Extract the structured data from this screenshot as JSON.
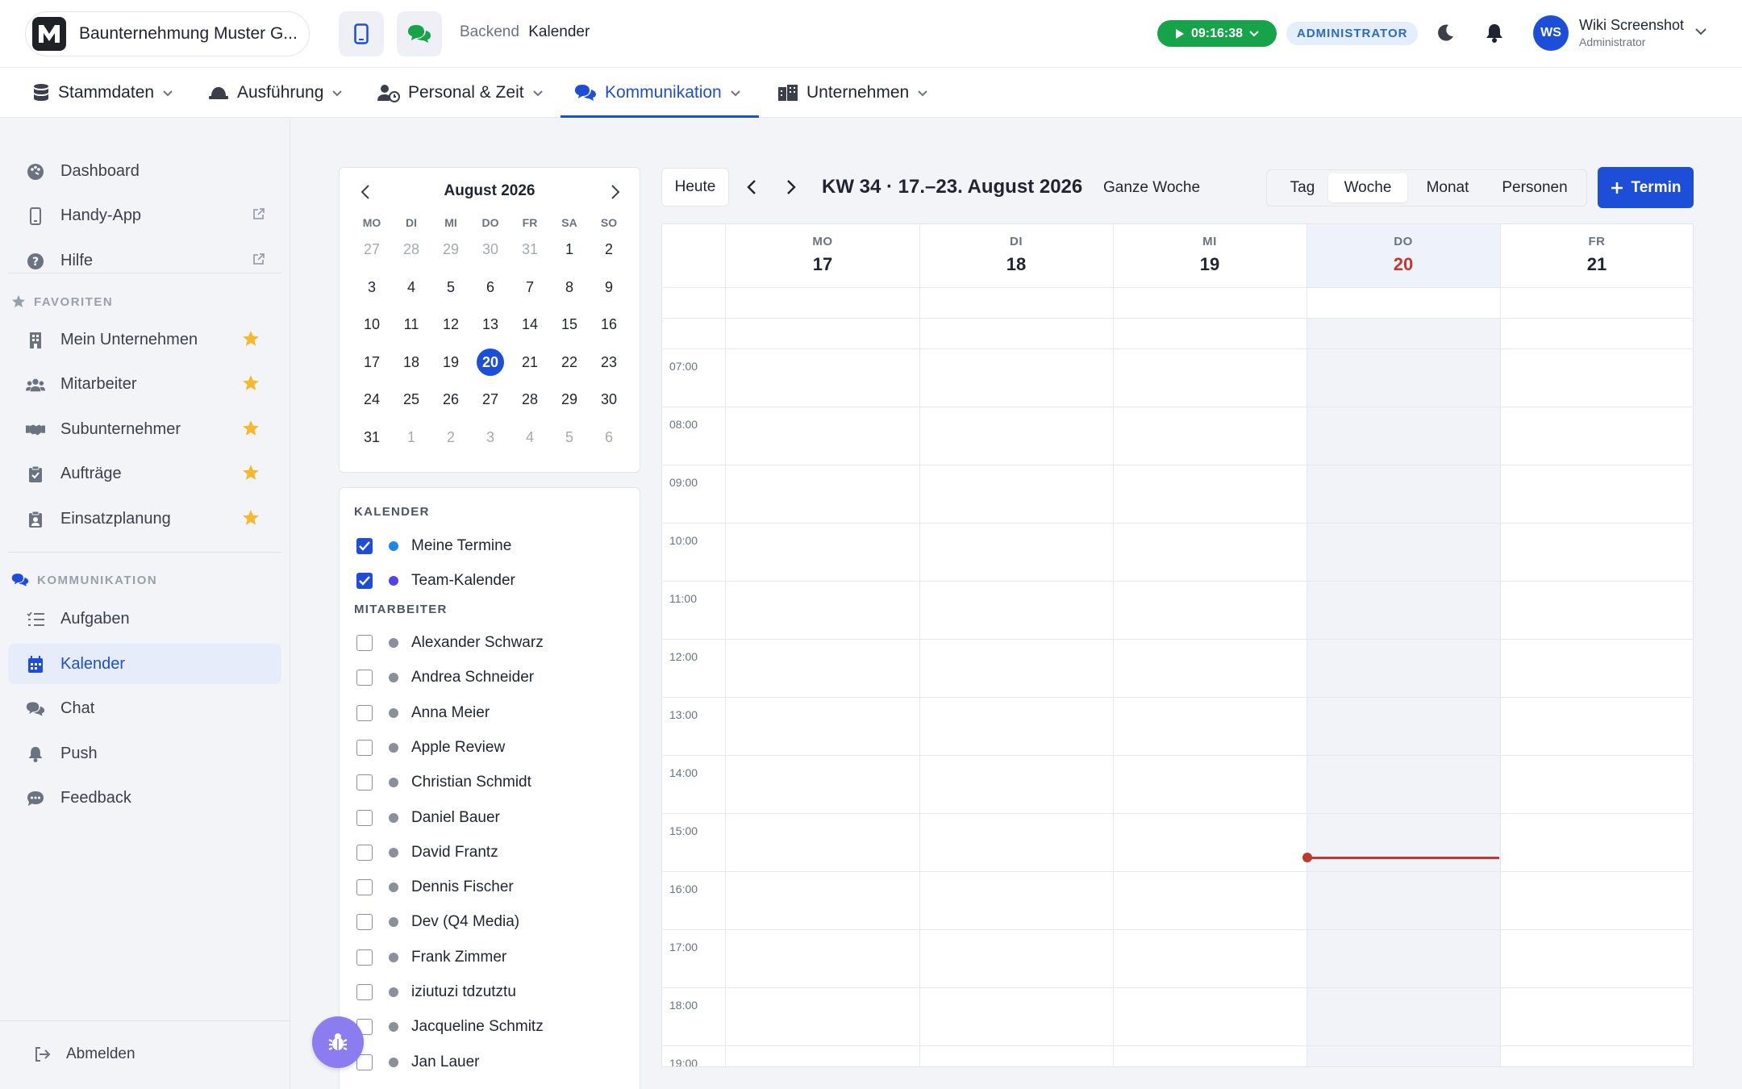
{
  "header": {
    "company": "Baunternehmung Muster G...",
    "breadcrumb": [
      "Backend",
      "Kalender"
    ],
    "timer": "09:16:38",
    "role": "ADMINISTRATOR",
    "user": {
      "name": "Wiki Screenshot",
      "role": "Administrator",
      "initials": "WS"
    }
  },
  "nav": [
    {
      "label": "Stammdaten",
      "icon": "database-icon"
    },
    {
      "label": "Ausführung",
      "icon": "hardhat-icon"
    },
    {
      "label": "Personal & Zeit",
      "icon": "user-clock-icon"
    },
    {
      "label": "Kommunikation",
      "icon": "comments-icon",
      "active": true
    },
    {
      "label": "Unternehmen",
      "icon": "building-icon"
    }
  ],
  "sidebar": {
    "top": [
      {
        "label": "Dashboard",
        "icon": "palette-icon"
      },
      {
        "label": "Handy-App",
        "icon": "phone-icon",
        "external": true
      },
      {
        "label": "Hilfe",
        "icon": "help-icon",
        "external": true
      }
    ],
    "favorites_title": "FAVORITEN",
    "favorites": [
      {
        "label": "Mein Unternehmen",
        "icon": "building-icon"
      },
      {
        "label": "Mitarbeiter",
        "icon": "users-icon"
      },
      {
        "label": "Subunternehmer",
        "icon": "handshake-icon"
      },
      {
        "label": "Aufträge",
        "icon": "clipboard-check-icon"
      },
      {
        "label": "Einsatzplanung",
        "icon": "clipboard-user-icon"
      }
    ],
    "communication_title": "KOMMUNIKATION",
    "communication": [
      {
        "label": "Aufgaben",
        "icon": "list-icon"
      },
      {
        "label": "Kalender",
        "icon": "calendar-icon",
        "active": true
      },
      {
        "label": "Chat",
        "icon": "chat-icon"
      },
      {
        "label": "Push",
        "icon": "bell-icon"
      },
      {
        "label": "Feedback",
        "icon": "comment-dots-icon"
      }
    ],
    "logout": "Abmelden"
  },
  "mini_calendar": {
    "title": "August 2026",
    "dow": [
      "MO",
      "DI",
      "MI",
      "DO",
      "FR",
      "SA",
      "SO"
    ],
    "weeks": [
      [
        {
          "d": "27",
          "m": true
        },
        {
          "d": "28",
          "m": true
        },
        {
          "d": "29",
          "m": true
        },
        {
          "d": "30",
          "m": true
        },
        {
          "d": "31",
          "m": true
        },
        {
          "d": "1"
        },
        {
          "d": "2"
        }
      ],
      [
        {
          "d": "3"
        },
        {
          "d": "4"
        },
        {
          "d": "5"
        },
        {
          "d": "6"
        },
        {
          "d": "7"
        },
        {
          "d": "8"
        },
        {
          "d": "9"
        }
      ],
      [
        {
          "d": "10"
        },
        {
          "d": "11"
        },
        {
          "d": "12"
        },
        {
          "d": "13"
        },
        {
          "d": "14"
        },
        {
          "d": "15"
        },
        {
          "d": "16"
        }
      ],
      [
        {
          "d": "17"
        },
        {
          "d": "18"
        },
        {
          "d": "19"
        },
        {
          "d": "20",
          "sel": true
        },
        {
          "d": "21"
        },
        {
          "d": "22"
        },
        {
          "d": "23"
        }
      ],
      [
        {
          "d": "24"
        },
        {
          "d": "25"
        },
        {
          "d": "26"
        },
        {
          "d": "27"
        },
        {
          "d": "28"
        },
        {
          "d": "29"
        },
        {
          "d": "30"
        }
      ],
      [
        {
          "d": "31"
        },
        {
          "d": "1",
          "m": true
        },
        {
          "d": "2",
          "m": true
        },
        {
          "d": "3",
          "m": true
        },
        {
          "d": "4",
          "m": true
        },
        {
          "d": "5",
          "m": true
        },
        {
          "d": "6",
          "m": true
        }
      ]
    ]
  },
  "calendars": {
    "heading": "KALENDER",
    "items": [
      {
        "label": "Meine Termine",
        "checked": true,
        "color": "#1e88e5"
      },
      {
        "label": "Team-Kalender",
        "checked": true,
        "color": "#4f46e5"
      }
    ],
    "employees_heading": "MITARBEITER",
    "employees": [
      "Alexander Schwarz",
      "Andrea Schneider",
      "Anna Meier",
      "Apple Review",
      "Christian Schmidt",
      "Daniel Bauer",
      "David Frantz",
      "Dennis Fischer",
      "Dev (Q4 Media)",
      "Frank Zimmer",
      "iziutuzi tdzutztu",
      "Jacqueline Schmitz",
      "Jan Lauer"
    ]
  },
  "toolbar": {
    "today": "Heute",
    "week_title": "KW 34 · 17.–23. August 2026",
    "full_week": "Ganze Woche",
    "views": [
      "Tag",
      "Woche",
      "Monat",
      "Personen"
    ],
    "active_view": "Woche",
    "add": "Termin"
  },
  "week": {
    "days": [
      {
        "dow": "MO",
        "num": "17"
      },
      {
        "dow": "DI",
        "num": "18"
      },
      {
        "dow": "MI",
        "num": "19"
      },
      {
        "dow": "DO",
        "num": "20",
        "today": true
      },
      {
        "dow": "FR",
        "num": "21"
      }
    ],
    "hours": [
      "07:00",
      "08:00",
      "09:00",
      "10:00",
      "11:00",
      "12:00",
      "13:00",
      "14:00",
      "15:00",
      "16:00",
      "17:00",
      "18:00",
      "19:00"
    ],
    "current_time": "16:00"
  },
  "colors": {
    "accent": "#1d4ed8",
    "today": "#c0392b",
    "timer": "#16a34a",
    "star": "#f5b82e"
  }
}
